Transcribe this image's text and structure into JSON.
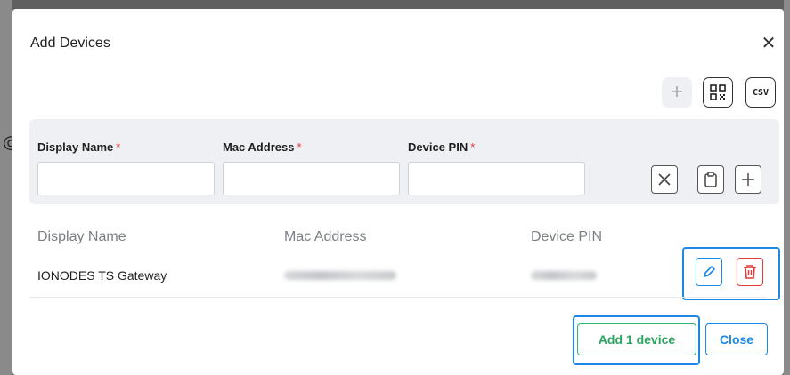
{
  "modal": {
    "title": "Add Devices",
    "close_icon": "close-icon"
  },
  "toolbar": {
    "add_icon": "plus-icon",
    "qr_icon": "qr-code-icon",
    "csv_label": "CSV"
  },
  "form": {
    "fields": [
      {
        "label": "Display Name",
        "required_mark": "*",
        "value": "",
        "placeholder": ""
      },
      {
        "label": "Mac Address",
        "required_mark": "*",
        "value": "",
        "placeholder": ""
      },
      {
        "label": "Device PIN",
        "required_mark": "*",
        "value": "",
        "placeholder": ""
      }
    ],
    "buttons": [
      "clear-icon",
      "clipboard-icon",
      "plus-icon"
    ]
  },
  "table": {
    "headers": [
      "Display Name",
      "Mac Address",
      "Device PIN"
    ],
    "rows": [
      {
        "display_name": "IONODES TS Gateway",
        "actions": [
          "pencil-icon",
          "trash-icon"
        ]
      }
    ]
  },
  "footer": {
    "add_label": "Add 1 device",
    "close_label": "Close"
  },
  "colors": {
    "accent_blue": "#1e88e5",
    "success_green": "#2aa561",
    "danger_red": "#e53935",
    "panel_bg": "#eef0f3"
  }
}
